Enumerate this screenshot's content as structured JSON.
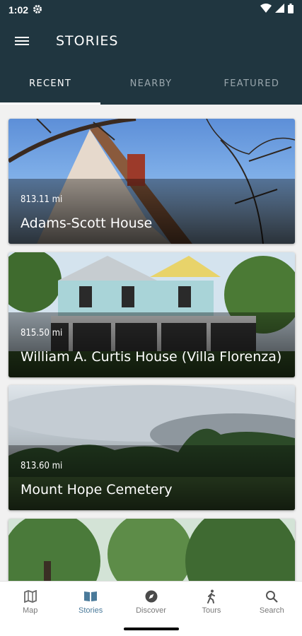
{
  "status_bar": {
    "time": "1:02"
  },
  "toolbar": {
    "title": "STORIES"
  },
  "tabs": [
    {
      "label": "RECENT",
      "active": true
    },
    {
      "label": "NEARBY",
      "active": false
    },
    {
      "label": "FEATURED",
      "active": false
    }
  ],
  "stories": [
    {
      "distance": "813.11 mi",
      "title": "Adams-Scott House"
    },
    {
      "distance": "815.50 mi",
      "title": "William A. Curtis House (Villa Florenza)"
    },
    {
      "distance": "813.60 mi",
      "title": "Mount Hope Cemetery"
    }
  ],
  "bottom_nav": [
    {
      "label": "Map",
      "icon": "map-icon",
      "active": false
    },
    {
      "label": "Stories",
      "icon": "book-icon",
      "active": true
    },
    {
      "label": "Discover",
      "icon": "compass-icon",
      "active": false
    },
    {
      "label": "Tours",
      "icon": "walking-icon",
      "active": false
    },
    {
      "label": "Search",
      "icon": "search-icon",
      "active": false
    }
  ]
}
